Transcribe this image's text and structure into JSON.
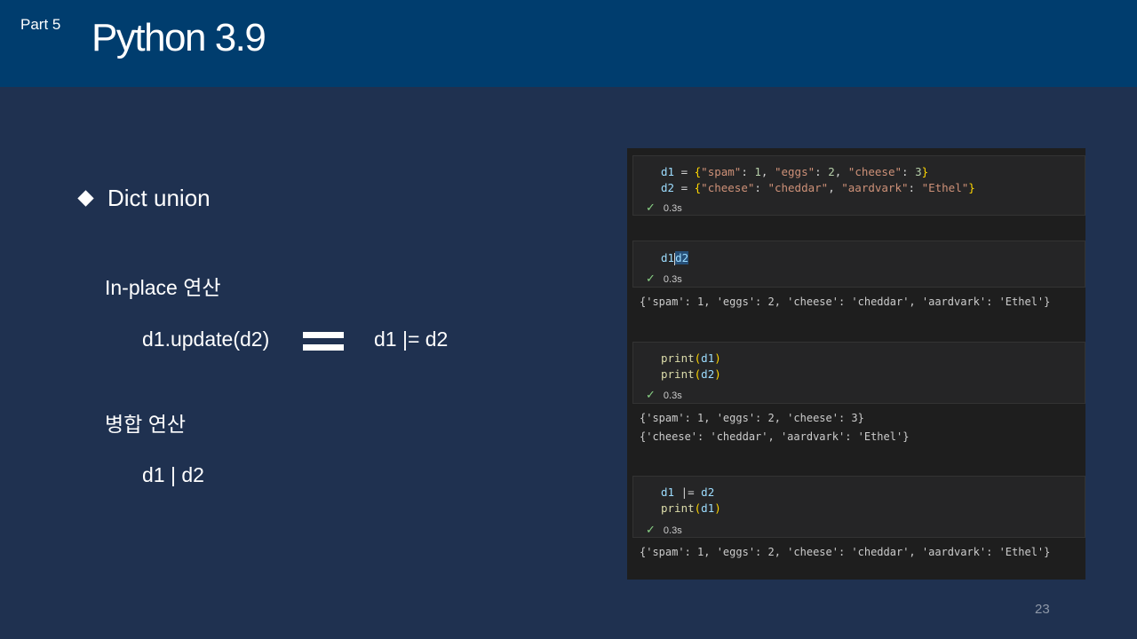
{
  "header": {
    "part": "Part 5",
    "title": "Python 3.9"
  },
  "slide": {
    "bullet": "Dict union",
    "inplace_label": "In-place 연산",
    "update_expr": "d1.update(d2)",
    "inplace_expr": "d1 |= d2",
    "merge_label": "병합 연산",
    "merge_expr": "d1 | d2",
    "page_number": "23"
  },
  "notebook": {
    "cells": [
      {
        "lines": [
          "d1 = {\"spam\": 1, \"eggs\": 2, \"cheese\": 3}",
          "d2 = {\"cheese\": \"cheddar\", \"aardvark\": \"Ethel\"}"
        ],
        "time": "0.3s",
        "output": []
      },
      {
        "lines": [
          "d1|d2"
        ],
        "time": "0.3s",
        "output": [
          "{'spam': 1, 'eggs': 2, 'cheese': 'cheddar', 'aardvark': 'Ethel'}"
        ]
      },
      {
        "lines": [
          "print(d1)",
          "print(d2)"
        ],
        "time": "0.3s",
        "output": [
          "{'spam': 1, 'eggs': 2, 'cheese': 3}",
          "{'cheese': 'cheddar', 'aardvark': 'Ethel'}"
        ]
      },
      {
        "lines": [
          "d1 |= d2",
          "print(d1)"
        ],
        "time": "0.3s",
        "output": [
          "{'spam': 1, 'eggs': 2, 'cheese': 'cheddar', 'aardvark': 'Ethel'}"
        ]
      }
    ]
  }
}
